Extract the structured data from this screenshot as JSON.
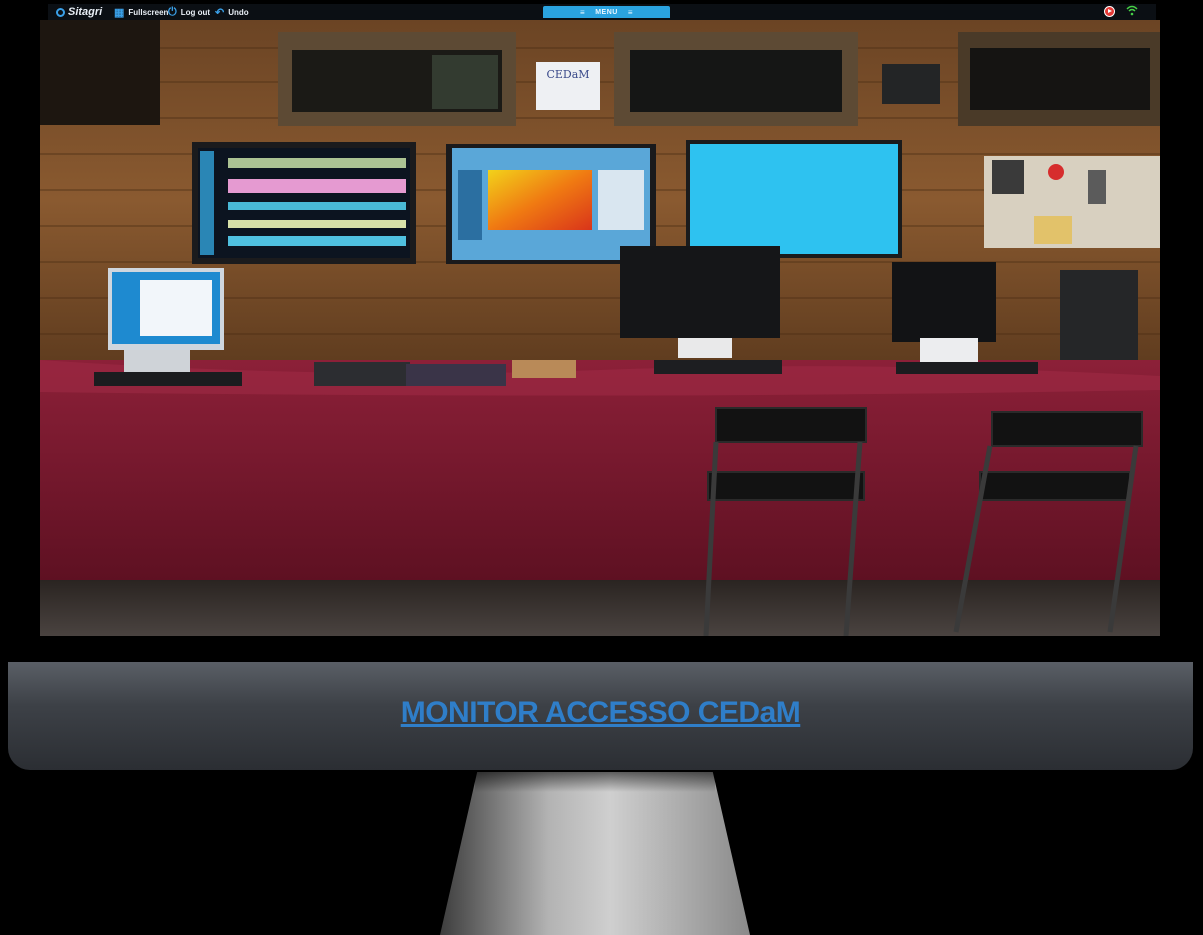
{
  "toolbar": {
    "brand": "Sitagri",
    "fullscreen_label": "Fullscreen",
    "logout_label": "Log out",
    "undo_label": "Undo",
    "menu_label": "MENU"
  },
  "icons": {
    "brand": "sitagri-logo-icon",
    "fullscreen": "grid-icon",
    "logout": "power-icon",
    "undo": "undo-icon",
    "record": "record-play-icon",
    "wifi": "wifi-icon"
  },
  "screen": {
    "sign_title": "CEDaM"
  },
  "chin": {
    "title": "MONITOR ACCESSO CEDaM"
  },
  "colors": {
    "accent": "#2aa3e0",
    "title": "#2f7ec9",
    "wood": "#8a5a30",
    "tablecloth": "#8a1f35"
  }
}
